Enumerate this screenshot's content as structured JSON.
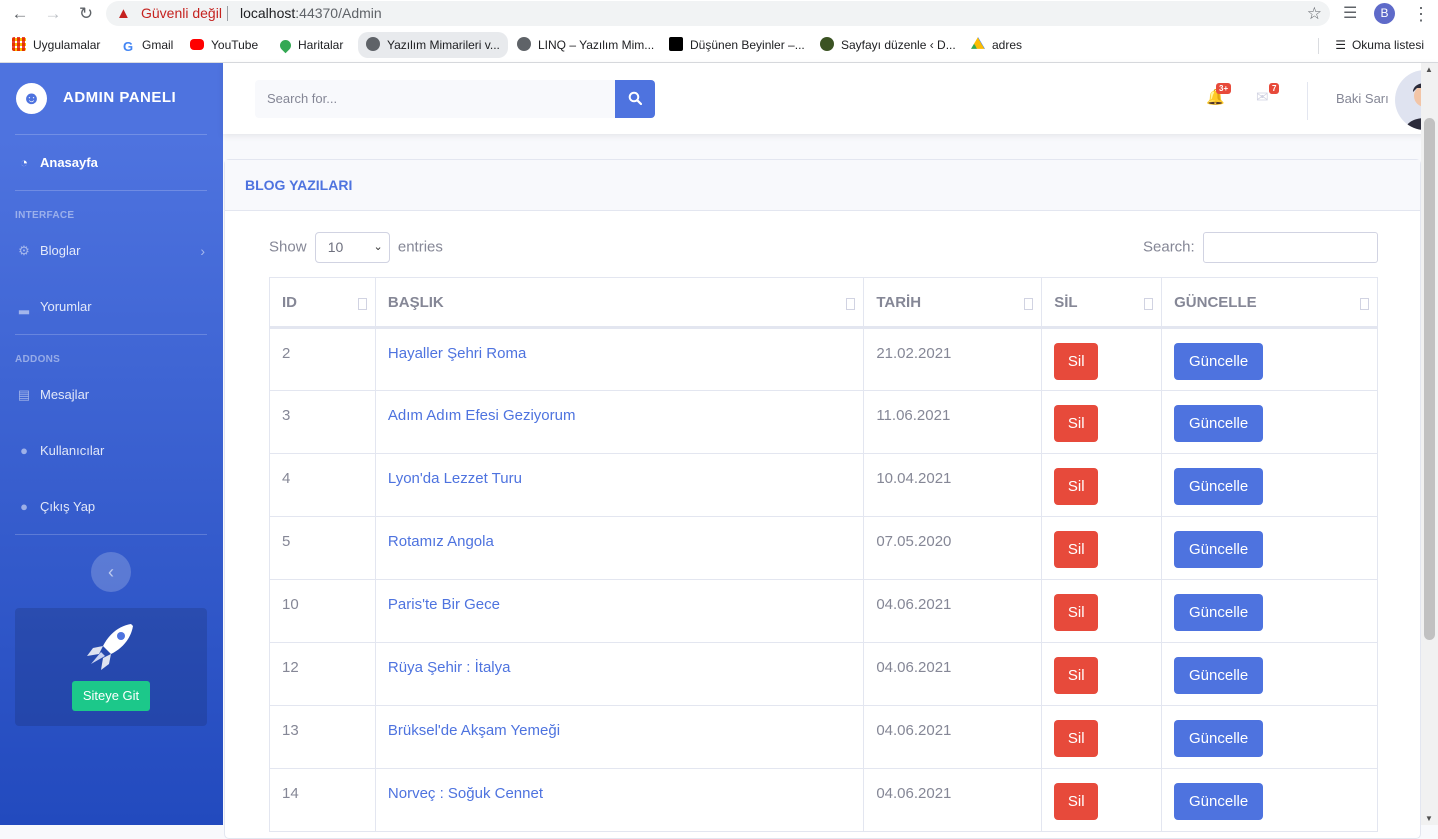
{
  "browser": {
    "security_label": "Güvenli değil",
    "url_host": "localhost",
    "url_path": ":44370/Admin",
    "profile_initial": "B",
    "bookmarks": [
      {
        "label": "Uygulamalar",
        "icon": "apps-grid-icon",
        "color": "#ea4335"
      },
      {
        "label": "Gmail",
        "icon": "google-g-icon",
        "color": "#4285f4"
      },
      {
        "label": "YouTube",
        "icon": "youtube-icon",
        "color": "#ff0000"
      },
      {
        "label": "Haritalar",
        "icon": "maps-pin-icon",
        "color": "#34a853"
      },
      {
        "label": "Yazılım Mimarileri v...",
        "icon": "globe-icon",
        "color": "#5f6368"
      },
      {
        "label": "LINQ – Yazılım Mim...",
        "icon": "globe-icon",
        "color": "#5f6368"
      },
      {
        "label": "Düşünen Beyinler –...",
        "icon": "medium-icon",
        "color": "#000000"
      },
      {
        "label": "Sayfayı düzenle ‹ D...",
        "icon": "wordpress-icon",
        "color": "#3b5323"
      },
      {
        "label": "adres",
        "icon": "drive-icon",
        "color": "#fbbc04"
      }
    ],
    "reading_list": "Okuma listesi"
  },
  "sidebar": {
    "brand": "ADMIN PANELI",
    "dashboard": "Anasayfa",
    "heading_interface": "INTERFACE",
    "heading_addons": "ADDONS",
    "items": [
      {
        "label": "Bloglar",
        "icon": "gear-icon"
      },
      {
        "label": "Yorumlar",
        "icon": "chart-area-icon"
      },
      {
        "label": "Mesajlar",
        "icon": "messages-icon"
      },
      {
        "label": "Kullanıcılar",
        "icon": "user-icon"
      },
      {
        "label": "Çıkış Yap",
        "icon": "user-icon"
      }
    ],
    "site_button": "Siteye Git"
  },
  "topbar": {
    "search_placeholder": "Search for...",
    "alerts_badge": "3+",
    "messages_badge": "7",
    "user_name": "Baki Sarı"
  },
  "card": {
    "title": "BLOG YAZILARI",
    "show_label": "Show",
    "entries_value": "10",
    "entries_label": "entries",
    "search_label": "Search:"
  },
  "table": {
    "headers": [
      "ID",
      "BAŞLIK",
      "TARİH",
      "SİL",
      "GÜNCELLE"
    ],
    "delete_label": "Sil",
    "update_label": "Güncelle",
    "rows": [
      {
        "id": "2",
        "title": "Hayaller Şehri Roma",
        "date": "21.02.2021"
      },
      {
        "id": "3",
        "title": "Adım Adım Efesi Geziyorum",
        "date": "11.06.2021"
      },
      {
        "id": "4",
        "title": "Lyon'da Lezzet Turu",
        "date": "10.04.2021"
      },
      {
        "id": "5",
        "title": "Rotamız Angola",
        "date": "07.05.2020"
      },
      {
        "id": "10",
        "title": "Paris'te Bir Gece",
        "date": "04.06.2021"
      },
      {
        "id": "12",
        "title": "Rüya Şehir : İtalya",
        "date": "04.06.2021"
      },
      {
        "id": "13",
        "title": "Brüksel'de Akşam Yemeği",
        "date": "04.06.2021"
      },
      {
        "id": "14",
        "title": "Norveç : Soğuk Cennet",
        "date": "04.06.2021"
      }
    ]
  }
}
